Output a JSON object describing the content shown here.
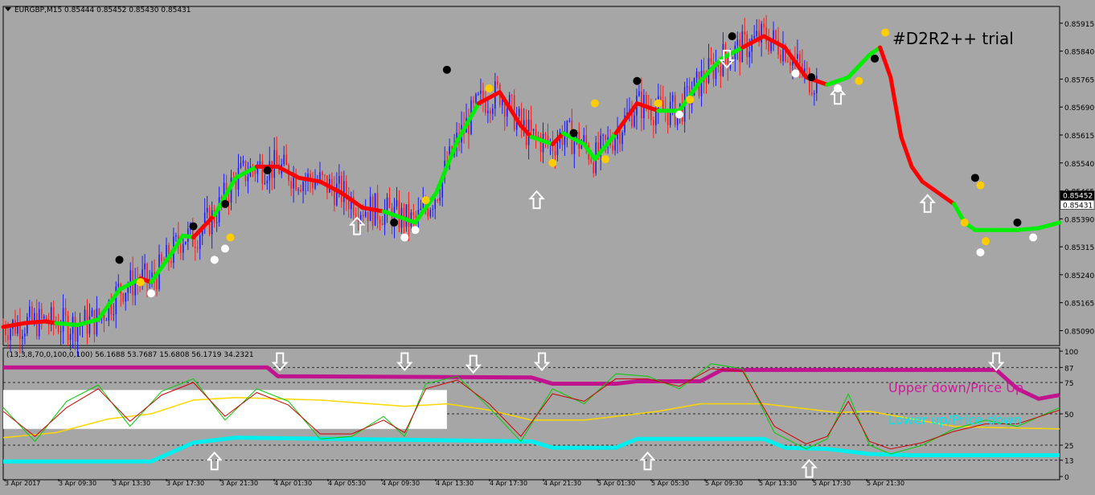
{
  "chart_data": [
    {
      "type": "candlestick",
      "symbol": "EURGBP,M15",
      "header": "EURGBP,M15  0.85444 0.85452 0.85430 0.85431",
      "watermark": "#D2R2++ trial",
      "ylim": [
        0.8505,
        0.8596
      ],
      "y_ticks": [
        "0.85915",
        "0.85840",
        "0.85765",
        "0.85690",
        "0.85615",
        "0.85540",
        "0.85465",
        "0.85390",
        "0.85315",
        "0.85240",
        "0.85165",
        "0.85090"
      ],
      "price_labels": [
        "0.85452",
        "0.85431"
      ],
      "x_ticks": [
        "3 Apr 2017",
        "3 Apr 09:30",
        "3 Apr 13:30",
        "3 Apr 17:30",
        "3 Apr 21:30",
        "4 Apr 01:30",
        "4 Apr 05:30",
        "4 Apr 09:30",
        "4 Apr 13:30",
        "4 Apr 17:30",
        "4 Apr 21:30",
        "5 Apr 01:30",
        "5 Apr 05:30",
        "5 Apr 09:30",
        "5 Apr 13:30",
        "5 Apr 17:30",
        "5 Apr 21:30"
      ],
      "trend_line": {
        "colors": {
          "up": "#00ee00",
          "down": "#ff0000"
        },
        "points": [
          [
            0,
            0.851
          ],
          [
            0.02,
            0.8511
          ],
          [
            0.04,
            0.85115
          ],
          [
            0.05,
            0.8511
          ],
          [
            0.07,
            0.85105
          ],
          [
            0.09,
            0.8512
          ],
          [
            0.11,
            0.852
          ],
          [
            0.13,
            0.8523
          ],
          [
            0.14,
            0.8522
          ],
          [
            0.16,
            0.853
          ],
          [
            0.17,
            0.85345
          ],
          [
            0.18,
            0.8534
          ],
          [
            0.2,
            0.854
          ],
          [
            0.22,
            0.855
          ],
          [
            0.24,
            0.8553
          ],
          [
            0.26,
            0.8553
          ],
          [
            0.28,
            0.855
          ],
          [
            0.3,
            0.8549
          ],
          [
            0.32,
            0.8546
          ],
          [
            0.34,
            0.8542
          ],
          [
            0.36,
            0.8541
          ],
          [
            0.38,
            0.8539
          ],
          [
            0.39,
            0.8538
          ],
          [
            0.41,
            0.8546
          ],
          [
            0.43,
            0.856
          ],
          [
            0.45,
            0.857
          ],
          [
            0.47,
            0.8573
          ],
          [
            0.49,
            0.8564
          ],
          [
            0.5,
            0.8561
          ],
          [
            0.52,
            0.8559
          ],
          [
            0.53,
            0.8562
          ],
          [
            0.55,
            0.8559
          ],
          [
            0.56,
            0.8555
          ],
          [
            0.58,
            0.8562
          ],
          [
            0.6,
            0.857
          ],
          [
            0.62,
            0.8568
          ],
          [
            0.64,
            0.8568
          ],
          [
            0.66,
            0.8576
          ],
          [
            0.68,
            0.8582
          ],
          [
            0.7,
            0.8585
          ],
          [
            0.72,
            0.8588
          ],
          [
            0.74,
            0.8585
          ],
          [
            0.76,
            0.8577
          ],
          [
            0.78,
            0.8575
          ],
          [
            0.8,
            0.8577
          ],
          [
            0.82,
            0.8583
          ],
          [
            0.83,
            0.8585
          ],
          [
            0.84,
            0.8577
          ],
          [
            0.85,
            0.8561
          ],
          [
            0.86,
            0.8553
          ],
          [
            0.87,
            0.8549
          ],
          [
            0.88,
            0.8547
          ],
          [
            0.89,
            0.8545
          ],
          [
            0.9,
            0.8543
          ],
          [
            0.91,
            0.8538
          ],
          [
            0.92,
            0.8536
          ],
          [
            0.94,
            0.8536
          ],
          [
            0.96,
            0.8536
          ],
          [
            0.98,
            0.85365
          ],
          [
            1,
            0.8538
          ]
        ],
        "trend": [
          "d",
          "d",
          "d",
          "u",
          "u",
          "u",
          "u",
          "d",
          "u",
          "u",
          "u",
          "d",
          "u",
          "u",
          "d",
          "d",
          "d",
          "d",
          "d",
          "d",
          "u",
          "u",
          "u",
          "u",
          "u",
          "d",
          "d",
          "d",
          "u",
          "d",
          "u",
          "u",
          "u",
          "d",
          "d",
          "u",
          "u",
          "u",
          "u",
          "d",
          "d",
          "d",
          "d",
          "u",
          "u",
          "u",
          "d",
          "d",
          "d",
          "d",
          "d",
          "d",
          "d",
          "u",
          "u",
          "u",
          "u",
          "u",
          "u",
          "u"
        ]
      },
      "dots": [
        {
          "x": 0.11,
          "y": 0.8528,
          "c": "#000000"
        },
        {
          "x": 0.13,
          "y": 0.8522,
          "c": "#ffcc00"
        },
        {
          "x": 0.14,
          "y": 0.8519,
          "c": "#ffffff"
        },
        {
          "x": 0.18,
          "y": 0.8537,
          "c": "#000000"
        },
        {
          "x": 0.21,
          "y": 0.8543,
          "c": "#000000"
        },
        {
          "x": 0.2,
          "y": 0.8528,
          "c": "#ffffff"
        },
        {
          "x": 0.21,
          "y": 0.8531,
          "c": "#ffffff"
        },
        {
          "x": 0.215,
          "y": 0.8534,
          "c": "#ffcc00"
        },
        {
          "x": 0.25,
          "y": 0.8552,
          "c": "#000000"
        },
        {
          "x": 0.37,
          "y": 0.8538,
          "c": "#000000"
        },
        {
          "x": 0.38,
          "y": 0.8534,
          "c": "#ffffff"
        },
        {
          "x": 0.39,
          "y": 0.8536,
          "c": "#ffffff"
        },
        {
          "x": 0.4,
          "y": 0.8544,
          "c": "#ffcc00"
        },
        {
          "x": 0.42,
          "y": 0.8579,
          "c": "#000000"
        },
        {
          "x": 0.46,
          "y": 0.8574,
          "c": "#ffcc00"
        },
        {
          "x": 0.52,
          "y": 0.8554,
          "c": "#ffcc00"
        },
        {
          "x": 0.54,
          "y": 0.8562,
          "c": "#000000"
        },
        {
          "x": 0.56,
          "y": 0.857,
          "c": "#ffcc00"
        },
        {
          "x": 0.57,
          "y": 0.8555,
          "c": "#ffcc00"
        },
        {
          "x": 0.6,
          "y": 0.8576,
          "c": "#000000"
        },
        {
          "x": 0.62,
          "y": 0.857,
          "c": "#ffcc00"
        },
        {
          "x": 0.64,
          "y": 0.8567,
          "c": "#ffffff"
        },
        {
          "x": 0.65,
          "y": 0.8571,
          "c": "#ffcc00"
        },
        {
          "x": 0.69,
          "y": 0.8588,
          "c": "#000000"
        },
        {
          "x": 0.75,
          "y": 0.8578,
          "c": "#ffffff"
        },
        {
          "x": 0.765,
          "y": 0.8577,
          "c": "#000000"
        },
        {
          "x": 0.79,
          "y": 0.8574,
          "c": "#ffffff"
        },
        {
          "x": 0.81,
          "y": 0.8576,
          "c": "#ffcc00"
        },
        {
          "x": 0.825,
          "y": 0.8582,
          "c": "#000000"
        },
        {
          "x": 0.835,
          "y": 0.8589,
          "c": "#ffcc00"
        },
        {
          "x": 0.91,
          "y": 0.8538,
          "c": "#ffcc00"
        },
        {
          "x": 0.92,
          "y": 0.855,
          "c": "#000000"
        },
        {
          "x": 0.925,
          "y": 0.8548,
          "c": "#ffcc00"
        },
        {
          "x": 0.93,
          "y": 0.8533,
          "c": "#ffcc00"
        },
        {
          "x": 0.925,
          "y": 0.853,
          "c": "#ffffff"
        },
        {
          "x": 0.96,
          "y": 0.8538,
          "c": "#000000"
        },
        {
          "x": 0.975,
          "y": 0.8534,
          "c": "#ffffff"
        }
      ],
      "arrows": [
        {
          "x": 0.335,
          "y": 0.8537,
          "dir": "up"
        },
        {
          "x": 0.505,
          "y": 0.8544,
          "dir": "up"
        },
        {
          "x": 0.685,
          "y": 0.8582,
          "dir": "down"
        },
        {
          "x": 0.79,
          "y": 0.8572,
          "dir": "up"
        },
        {
          "x": 0.875,
          "y": 0.8543,
          "dir": "up"
        }
      ]
    },
    {
      "type": "line",
      "header": "(13,3,8,70,0,100,0,100) 56.1688 53.7687 15.6808 56.1719 34.2321",
      "ylim": [
        0,
        100
      ],
      "y_ticks": [
        100,
        87,
        75,
        50,
        25,
        13,
        0
      ],
      "levels": [
        87,
        75,
        50,
        25,
        13
      ],
      "legend": [
        {
          "label": "Upper down/Price Up",
          "color": "#cc1a99"
        },
        {
          "label": "Lower up/Price down",
          "color": "#00e5ee"
        }
      ],
      "series": [
        {
          "color": "#c0148f",
          "width": 5,
          "points": [
            [
              0,
              87
            ],
            [
              0.25,
              87
            ],
            [
              0.26,
              80
            ],
            [
              0.5,
              79
            ],
            [
              0.52,
              74
            ],
            [
              0.58,
              74
            ],
            [
              0.6,
              76
            ],
            [
              0.66,
              76
            ],
            [
              0.68,
              85
            ],
            [
              0.94,
              85
            ],
            [
              0.96,
              70
            ],
            [
              0.98,
              62
            ],
            [
              1,
              65
            ]
          ]
        },
        {
          "color": "#00eeee",
          "width": 5,
          "points": [
            [
              0,
              12
            ],
            [
              0.14,
              12
            ],
            [
              0.18,
              27
            ],
            [
              0.22,
              31
            ],
            [
              0.5,
              28
            ],
            [
              0.52,
              23
            ],
            [
              0.58,
              23
            ],
            [
              0.6,
              30
            ],
            [
              0.72,
              30
            ],
            [
              0.74,
              23
            ],
            [
              0.78,
              22
            ],
            [
              0.82,
              18
            ],
            [
              0.86,
              17
            ],
            [
              1,
              17
            ]
          ]
        },
        {
          "color": "#ffd700",
          "width": 1.5,
          "points": [
            [
              0,
              31
            ],
            [
              0.05,
              35
            ],
            [
              0.1,
              46
            ],
            [
              0.14,
              50
            ],
            [
              0.18,
              61
            ],
            [
              0.22,
              63
            ],
            [
              0.3,
              61
            ],
            [
              0.38,
              56
            ],
            [
              0.42,
              58
            ],
            [
              0.46,
              53
            ],
            [
              0.5,
              45
            ],
            [
              0.55,
              45
            ],
            [
              0.62,
              52
            ],
            [
              0.66,
              58
            ],
            [
              0.72,
              58
            ],
            [
              0.79,
              51
            ],
            [
              0.82,
              52
            ],
            [
              0.86,
              46
            ],
            [
              0.9,
              40
            ],
            [
              0.94,
              39
            ],
            [
              1,
              38
            ]
          ]
        },
        {
          "color": "#00cc00",
          "width": 1,
          "points": [
            [
              0,
              55
            ],
            [
              0.03,
              28
            ],
            [
              0.06,
              60
            ],
            [
              0.09,
              73
            ],
            [
              0.12,
              40
            ],
            [
              0.15,
              68
            ],
            [
              0.18,
              78
            ],
            [
              0.21,
              45
            ],
            [
              0.24,
              70
            ],
            [
              0.27,
              60
            ],
            [
              0.3,
              30
            ],
            [
              0.33,
              32
            ],
            [
              0.36,
              48
            ],
            [
              0.38,
              32
            ],
            [
              0.4,
              74
            ],
            [
              0.43,
              80
            ],
            [
              0.46,
              55
            ],
            [
              0.49,
              28
            ],
            [
              0.52,
              70
            ],
            [
              0.55,
              58
            ],
            [
              0.58,
              82
            ],
            [
              0.61,
              80
            ],
            [
              0.64,
              70
            ],
            [
              0.67,
              90
            ],
            [
              0.7,
              86
            ],
            [
              0.73,
              35
            ],
            [
              0.76,
              22
            ],
            [
              0.78,
              30
            ],
            [
              0.8,
              66
            ],
            [
              0.82,
              25
            ],
            [
              0.84,
              18
            ],
            [
              0.87,
              25
            ],
            [
              0.9,
              38
            ],
            [
              0.93,
              45
            ],
            [
              0.96,
              40
            ],
            [
              1,
              55
            ]
          ]
        },
        {
          "color": "#cc0000",
          "width": 1,
          "points": [
            [
              0,
              52
            ],
            [
              0.03,
              32
            ],
            [
              0.06,
              55
            ],
            [
              0.09,
              70
            ],
            [
              0.12,
              44
            ],
            [
              0.15,
              65
            ],
            [
              0.18,
              75
            ],
            [
              0.21,
              48
            ],
            [
              0.24,
              67
            ],
            [
              0.27,
              57
            ],
            [
              0.3,
              34
            ],
            [
              0.33,
              34
            ],
            [
              0.36,
              45
            ],
            [
              0.38,
              35
            ],
            [
              0.4,
              70
            ],
            [
              0.43,
              77
            ],
            [
              0.46,
              58
            ],
            [
              0.49,
              32
            ],
            [
              0.52,
              66
            ],
            [
              0.55,
              60
            ],
            [
              0.58,
              78
            ],
            [
              0.61,
              78
            ],
            [
              0.64,
              72
            ],
            [
              0.67,
              86
            ],
            [
              0.7,
              84
            ],
            [
              0.73,
              40
            ],
            [
              0.76,
              26
            ],
            [
              0.78,
              32
            ],
            [
              0.8,
              60
            ],
            [
              0.82,
              28
            ],
            [
              0.84,
              22
            ],
            [
              0.87,
              27
            ],
            [
              0.9,
              36
            ],
            [
              0.93,
              42
            ],
            [
              0.96,
              42
            ],
            [
              1,
              53
            ]
          ]
        }
      ],
      "arrows": [
        {
          "x": 0.262,
          "v": 92,
          "dir": "down"
        },
        {
          "x": 0.38,
          "v": 92,
          "dir": "down"
        },
        {
          "x": 0.445,
          "v": 90,
          "dir": "down"
        },
        {
          "x": 0.51,
          "v": 92,
          "dir": "down"
        },
        {
          "x": 0.94,
          "v": 92,
          "dir": "down"
        },
        {
          "x": 0.2,
          "v": 12,
          "dir": "up"
        },
        {
          "x": 0.61,
          "v": 12,
          "dir": "up"
        },
        {
          "x": 0.763,
          "v": 6,
          "dir": "up"
        }
      ]
    }
  ]
}
